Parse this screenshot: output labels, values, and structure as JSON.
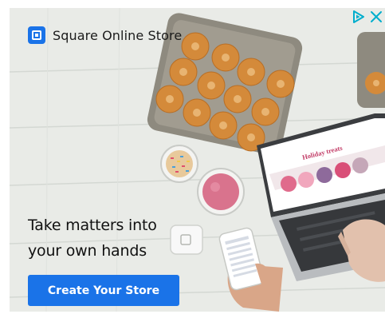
{
  "brand": {
    "name": "Square Online Store",
    "logo_icon": "square-logo-icon",
    "color": "#1a73e8"
  },
  "ad_controls": {
    "adchoices_icon": "adchoices-triangle-icon",
    "close_icon": "close-icon",
    "color": "#00aecd"
  },
  "headline": {
    "line1": "Take matters into",
    "line2": "your own hands"
  },
  "cta": {
    "label": "Create Your Store",
    "color": "#1a73e8"
  },
  "laptop_screen": {
    "title": "Holiday treats"
  }
}
